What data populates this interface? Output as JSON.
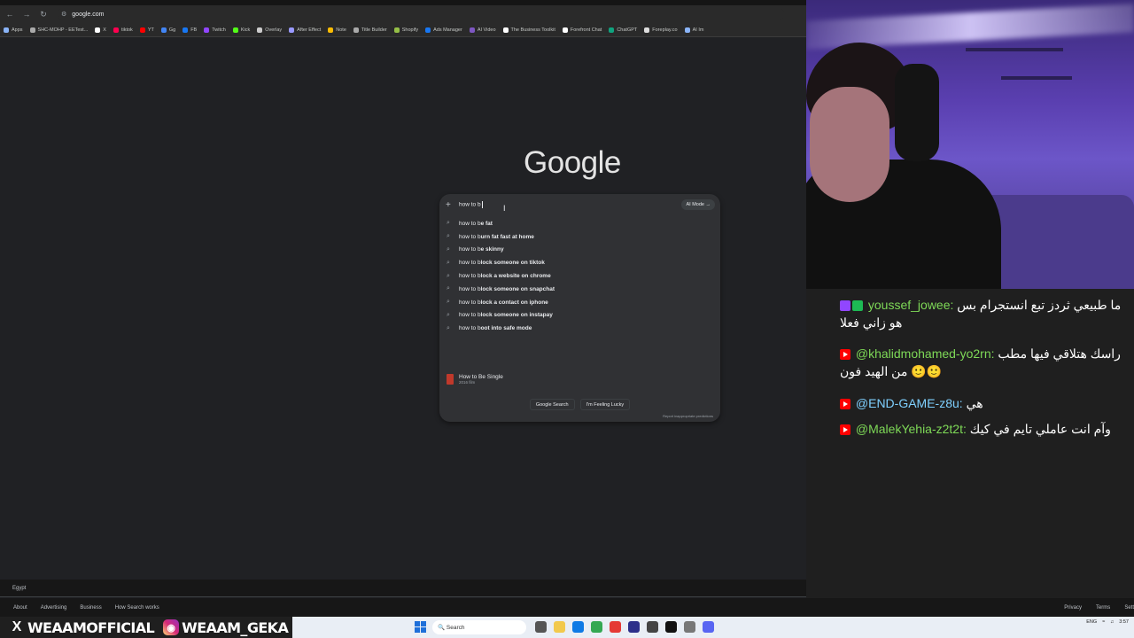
{
  "browser": {
    "url": "google.com",
    "bookmarks": [
      "Apps",
      "SHC-MOHP - EETest...",
      "X",
      "tiktok",
      "YT",
      "Gg",
      "FB",
      "Twitch",
      "Kick",
      "Overlay",
      "After Effect",
      "Note",
      "Title Builder",
      "Shopify",
      "Ads Manager",
      "AI Video",
      "The Business Toolkit",
      "Forefront Chat",
      "ChatGPT",
      "Foreplay.co",
      "AI Im"
    ]
  },
  "google": {
    "logo": "Google",
    "query": "how to b",
    "ai_mode": "AI Mode",
    "suggestions": [
      {
        "prefix": "how to b",
        "rest": "e fat"
      },
      {
        "prefix": "how to b",
        "rest": "urn fat fast at home"
      },
      {
        "prefix": "how to b",
        "rest": "e skinny"
      },
      {
        "prefix": "how to b",
        "rest": "lock someone on tiktok"
      },
      {
        "prefix": "how to b",
        "rest": "lock a website on chrome"
      },
      {
        "prefix": "how to b",
        "rest": "lock someone on snapchat"
      },
      {
        "prefix": "how to b",
        "rest": "lock a contact on iphone"
      },
      {
        "prefix": "how to b",
        "rest": "lock someone on instapay"
      },
      {
        "prefix": "how to b",
        "rest": "oot into safe mode"
      }
    ],
    "entity": {
      "title": "How to Be Single",
      "subtitle": "2016 film"
    },
    "buttons": {
      "search": "Google Search",
      "lucky": "I'm Feeling Lucky"
    },
    "report": "Report inappropriate predictions"
  },
  "footer": {
    "country": "Egypt",
    "left_links": [
      "About",
      "Advertising",
      "Business",
      "How Search works"
    ],
    "right_links": [
      "Privacy",
      "Terms",
      "Sett"
    ]
  },
  "chat": {
    "messages": [
      {
        "user": "youssef_jowee:",
        "text": "ما طبيعي ثردز تبع انستجرام بس هو زاني فعلا",
        "color": "green"
      },
      {
        "user": "@khalidmohamed-yo2rn:",
        "text": "راسك هتلاقي فيها مطب من الهيد فون 🙂🙂",
        "color": "green"
      },
      {
        "user": "@END-GAME-z8u:",
        "text": "هي",
        "color": "blue"
      },
      {
        "user": "@MalekYehia-z2t2t:",
        "text": "وآم انت عاملي تايم في كيك",
        "color": "green"
      }
    ]
  },
  "social": {
    "x_handle": "WEAAMOFFICIAL",
    "ig_handle": "WEAAM_GEKA"
  },
  "taskbar": {
    "search_placeholder": "Search",
    "tray_lang": "ENG",
    "time": "3:57"
  }
}
